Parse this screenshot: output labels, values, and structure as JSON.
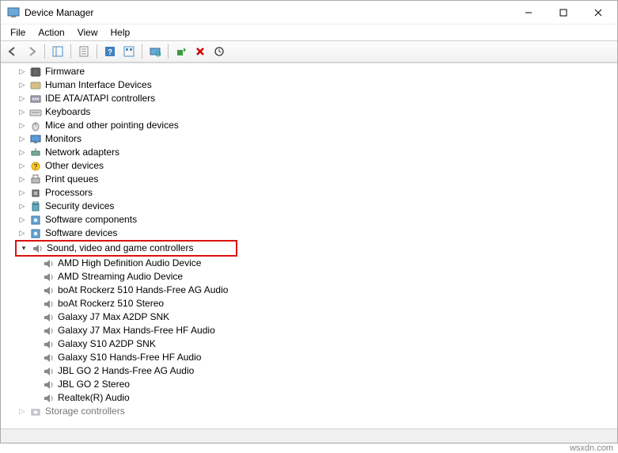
{
  "window": {
    "title": "Device Manager"
  },
  "menu": {
    "file": "File",
    "action": "Action",
    "view": "View",
    "help": "Help"
  },
  "categories": [
    {
      "name": "Firmware",
      "icon": "chip"
    },
    {
      "name": "Human Interface Devices",
      "icon": "hid"
    },
    {
      "name": "IDE ATA/ATAPI controllers",
      "icon": "ide"
    },
    {
      "name": "Keyboards",
      "icon": "keyboard"
    },
    {
      "name": "Mice and other pointing devices",
      "icon": "mouse"
    },
    {
      "name": "Monitors",
      "icon": "monitor"
    },
    {
      "name": "Network adapters",
      "icon": "network"
    },
    {
      "name": "Other devices",
      "icon": "other"
    },
    {
      "name": "Print queues",
      "icon": "printer"
    },
    {
      "name": "Processors",
      "icon": "cpu"
    },
    {
      "name": "Security devices",
      "icon": "security"
    },
    {
      "name": "Software components",
      "icon": "sw"
    },
    {
      "name": "Software devices",
      "icon": "sw"
    }
  ],
  "expanded": {
    "name": "Sound, video and game controllers",
    "children": [
      "AMD High Definition Audio Device",
      "AMD Streaming Audio Device",
      "boAt Rockerz 510 Hands-Free AG Audio",
      "boAt Rockerz 510 Stereo",
      "Galaxy J7 Max A2DP SNK",
      "Galaxy J7 Max Hands-Free HF Audio",
      "Galaxy S10 A2DP SNK",
      "Galaxy S10 Hands-Free HF Audio",
      "JBL GO 2 Hands-Free AG Audio",
      "JBL GO 2 Stereo",
      "Realtek(R) Audio"
    ]
  },
  "tail": {
    "name": "Storage controllers"
  },
  "watermark": "wsxdn.com"
}
